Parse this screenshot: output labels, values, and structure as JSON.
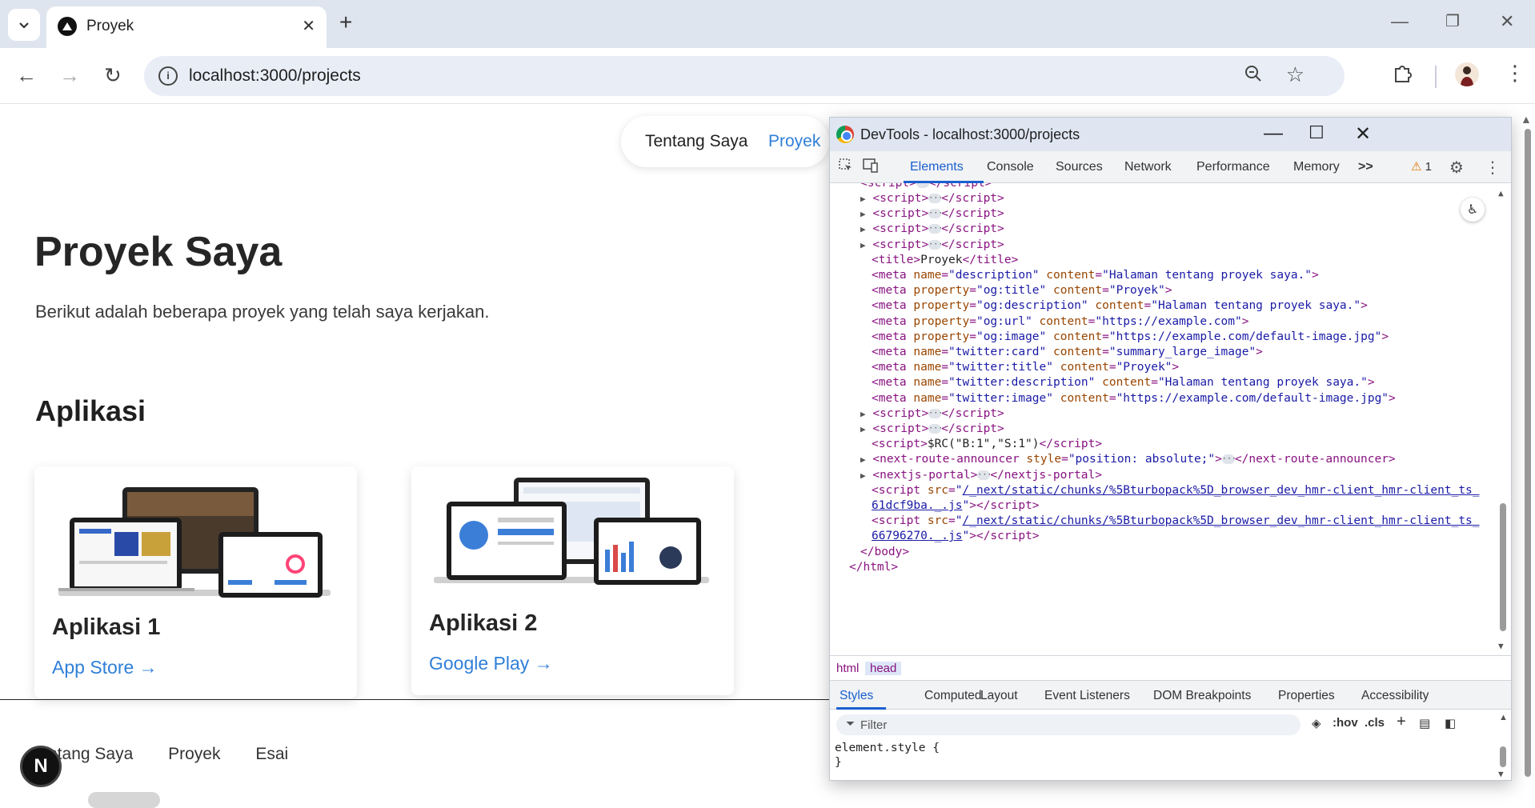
{
  "browser": {
    "tab_title": "Proyek",
    "new_tab_label": "+",
    "url": "localhost:3000/projects",
    "icons": {
      "tab_list": "chevron-down-icon",
      "tab_close": "close-icon",
      "back": "arrow-left-icon",
      "forward": "arrow-right-icon",
      "reload": "reload-icon",
      "site_info": "info-icon",
      "zoom": "zoom-icon",
      "bookmark": "star-icon",
      "extensions": "puzzle-icon",
      "profile": "avatar",
      "menu": "kebab-menu-icon"
    }
  },
  "page": {
    "nav": {
      "about": "Tentang Saya",
      "projects": "Proyek"
    },
    "title": "Proyek Saya",
    "subtitle": "Berikut adalah beberapa proyek yang telah saya kerjakan.",
    "section_heading": "Aplikasi",
    "cards": [
      {
        "title": "Aplikasi 1",
        "link": "App Store →"
      },
      {
        "title": "Aplikasi 2",
        "link": "Google Play →"
      }
    ],
    "footer_nav": [
      "ntang Saya",
      "Proyek",
      "Esai"
    ],
    "next_badge": "N",
    "accent_color": "#2f7fd8"
  },
  "devtools": {
    "window_title": "DevTools - localhost:3000/projects",
    "tabs": [
      "Elements",
      "Console",
      "Sources",
      "Network",
      "Performance",
      "Memory"
    ],
    "more_tabs": ">>",
    "warning_count": "1",
    "dom_lines": [
      {
        "type": "collapsed_script"
      },
      {
        "type": "collapsed_script"
      },
      {
        "type": "collapsed_script"
      },
      {
        "type": "collapsed_script"
      },
      {
        "type": "title",
        "text": "Proyek"
      },
      {
        "type": "meta",
        "key": "name",
        "keyval": "description",
        "content": "Halaman tentang proyek saya."
      },
      {
        "type": "meta",
        "key": "property",
        "keyval": "og:title",
        "content": "Proyek"
      },
      {
        "type": "meta",
        "key": "property",
        "keyval": "og:description",
        "content": "Halaman tentang proyek saya."
      },
      {
        "type": "meta",
        "key": "property",
        "keyval": "og:url",
        "content": "https://example.com"
      },
      {
        "type": "meta",
        "key": "property",
        "keyval": "og:image",
        "content": "https://example.com/default-image.jpg"
      },
      {
        "type": "meta",
        "key": "name",
        "keyval": "twitter:card",
        "content": "summary_large_image"
      },
      {
        "type": "meta",
        "key": "name",
        "keyval": "twitter:title",
        "content": "Proyek"
      },
      {
        "type": "meta",
        "key": "name",
        "keyval": "twitter:description",
        "content": "Halaman tentang proyek saya."
      },
      {
        "type": "meta",
        "key": "name",
        "keyval": "twitter:image",
        "content": "https://example.com/default-image.jpg"
      },
      {
        "type": "collapsed_script"
      },
      {
        "type": "collapsed_script"
      },
      {
        "type": "inline_script",
        "text": "$RC(\"B:1\",\"S:1\")"
      },
      {
        "type": "element_attr",
        "tag": "next-route-announcer",
        "attr": "style",
        "val": "position: absolute;"
      },
      {
        "type": "element",
        "tag": "nextjs-portal"
      },
      {
        "type": "src_script",
        "src1": "/_next/static/chunks/%5Bturbopack%5D_browser_dev_hmr-client_hmr-client_ts_",
        "src2": "61dcf9ba._.js"
      },
      {
        "type": "src_script",
        "src1": "/_next/static/chunks/%5Bturbopack%5D_browser_dev_hmr-client_hmr-client_ts_",
        "src2": "66796270._.js"
      },
      {
        "type": "close",
        "tag": "body"
      },
      {
        "type": "close",
        "tag": "html"
      }
    ],
    "breadcrumb": [
      "html",
      "head"
    ],
    "sub_tabs": [
      "Styles",
      "Computed",
      "Layout",
      "Event Listeners",
      "DOM Breakpoints",
      "Properties",
      "Accessibility"
    ],
    "filter_placeholder": "Filter",
    "filter_tools": [
      ":hov",
      ".cls"
    ],
    "element_style_open": "element.style {",
    "element_style_close": "}"
  }
}
